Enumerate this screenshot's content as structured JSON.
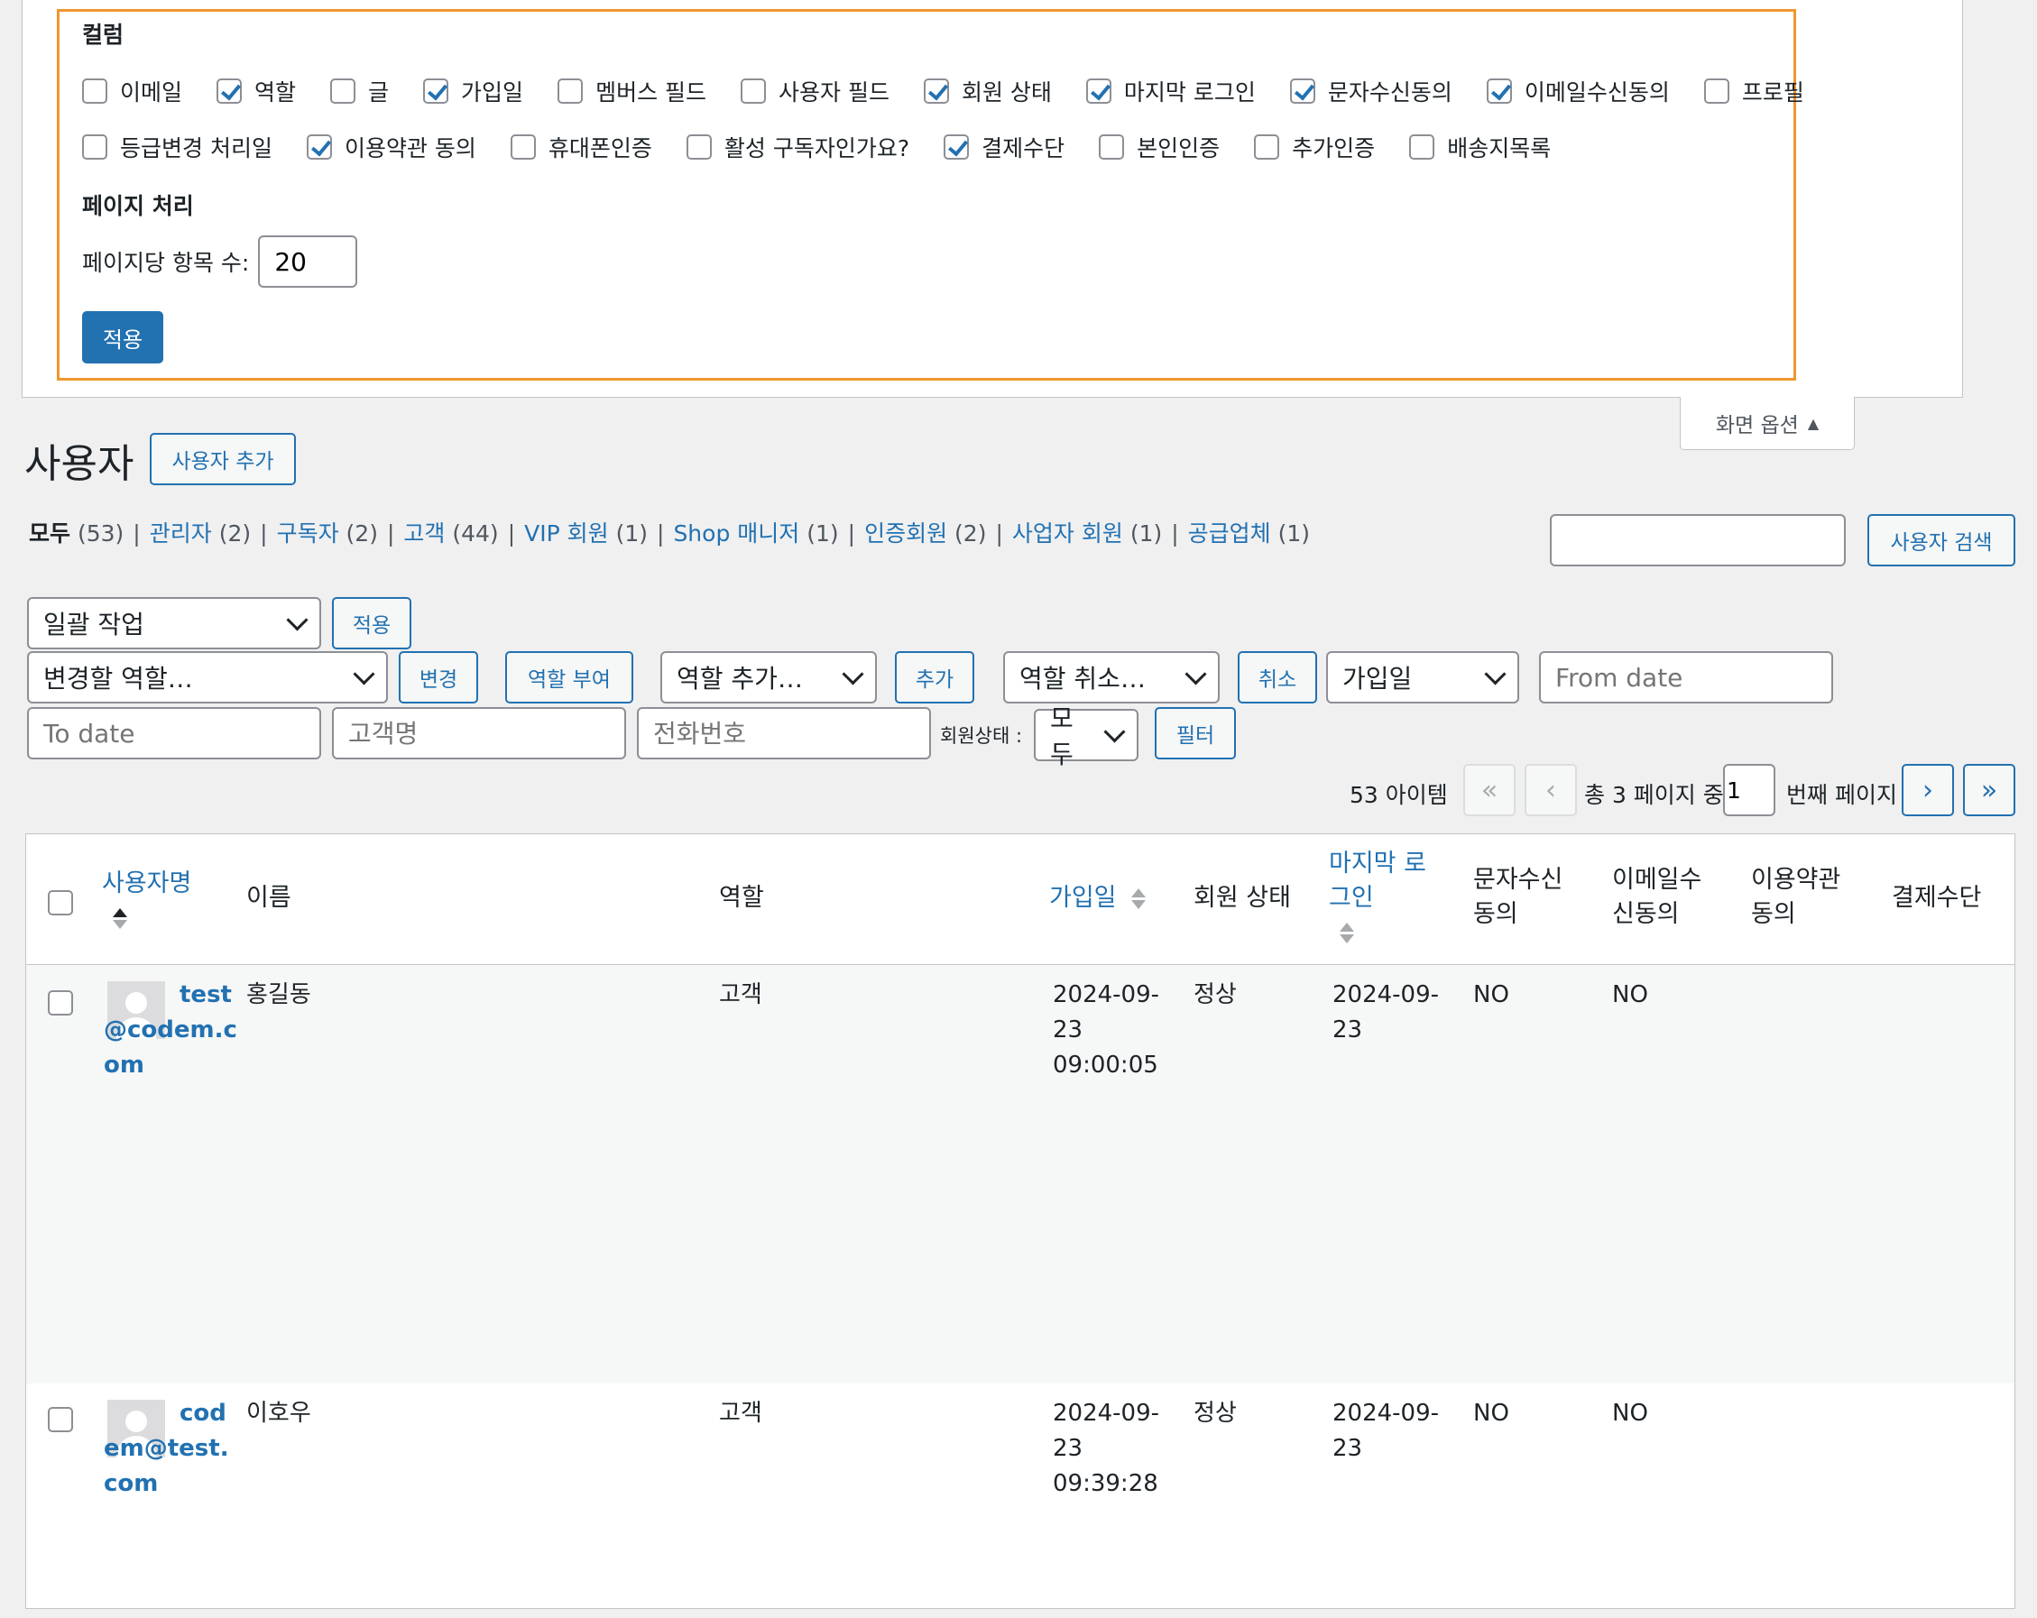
{
  "screen_options": {
    "columns_title": "컬럼",
    "columns_row1": [
      {
        "label": "이메일",
        "checked": false
      },
      {
        "label": "역할",
        "checked": true
      },
      {
        "label": "글",
        "checked": false
      },
      {
        "label": "가입일",
        "checked": true
      },
      {
        "label": "멤버스 필드",
        "checked": false
      },
      {
        "label": "사용자 필드",
        "checked": false
      },
      {
        "label": "회원 상태",
        "checked": true
      },
      {
        "label": "마지막 로그인",
        "checked": true
      },
      {
        "label": "문자수신동의",
        "checked": true
      },
      {
        "label": "이메일수신동의",
        "checked": true
      },
      {
        "label": "프로필",
        "checked": false
      }
    ],
    "columns_row2": [
      {
        "label": "등급변경 처리일",
        "checked": false
      },
      {
        "label": "이용약관 동의",
        "checked": true
      },
      {
        "label": "휴대폰인증",
        "checked": false
      },
      {
        "label": "활성 구독자인가요?",
        "checked": false
      },
      {
        "label": "결제수단",
        "checked": true
      },
      {
        "label": "본인인증",
        "checked": false
      },
      {
        "label": "추가인증",
        "checked": false
      },
      {
        "label": "배송지목록",
        "checked": false
      }
    ],
    "pagination_title": "페이지 처리",
    "per_page_label": "페이지당 항목 수:",
    "per_page_value": "20",
    "apply_label": "적용",
    "tab_label": "화면 옵션",
    "tab_arrow": "▲"
  },
  "header": {
    "title": "사용자",
    "add_user": "사용자 추가"
  },
  "views": [
    {
      "label": "모두",
      "count": "(53)",
      "current": true
    },
    {
      "label": "관리자",
      "count": "(2)"
    },
    {
      "label": "구독자",
      "count": "(2)"
    },
    {
      "label": "고객",
      "count": "(44)"
    },
    {
      "label": "VIP 회원",
      "count": "(1)"
    },
    {
      "label": "Shop 매니저",
      "count": "(1)"
    },
    {
      "label": "인증회원",
      "count": "(2)"
    },
    {
      "label": "사업자 회원",
      "count": "(1)"
    },
    {
      "label": "공급업체",
      "count": "(1)"
    }
  ],
  "search": {
    "value": "",
    "button": "사용자 검색"
  },
  "bulk": {
    "select": "일괄 작업",
    "apply": "적용"
  },
  "role_tools": {
    "change_select": "변경할 역할…",
    "change_btn": "변경",
    "grant_btn": "역할 부여",
    "add_select": "역할 추가…",
    "add_btn": "추가",
    "remove_select": "역할 취소…",
    "remove_btn": "취소",
    "date_field_select": "가입일",
    "from_date_placeholder": "From date",
    "to_date_placeholder": "To date",
    "customer_placeholder": "고객명",
    "phone_placeholder": "전화번호",
    "status_label": "회원상태 :",
    "status_select": "모두",
    "filter_btn": "필터"
  },
  "pagination": {
    "items": "53 아이템",
    "first": "«",
    "prev": "‹",
    "total_text": "총 3 페이지 중",
    "current": "1",
    "page_suffix": "번째 페이지",
    "next": "›",
    "last": "»"
  },
  "table": {
    "headers": {
      "username": "사용자명",
      "name": "이름",
      "role": "역할",
      "registered": "가입일",
      "status": "회원 상태",
      "last_login": "마지막 로그인",
      "sms": "문자수신동의",
      "email_consent": "이메일수신동의",
      "terms": "이용약관동의",
      "payment": "결제수단"
    },
    "rows": [
      {
        "username": "test@codem.com",
        "name": "홍길동",
        "role": "고객",
        "registered": "2024-09-23 09:00:05",
        "status": "정상",
        "last_login": "2024-09-23",
        "sms": "NO",
        "email_consent": "NO"
      },
      {
        "username": "codem@test.com",
        "name": "이호우",
        "role": "고객",
        "registered": "2024-09-23 09:39:28",
        "status": "정상",
        "last_login": "2024-09-23",
        "sms": "NO",
        "email_consent": "NO"
      }
    ]
  },
  "colors": {
    "accent": "#2271b1",
    "highlight_border": "#f0962e",
    "background": "#f0f0f1"
  }
}
